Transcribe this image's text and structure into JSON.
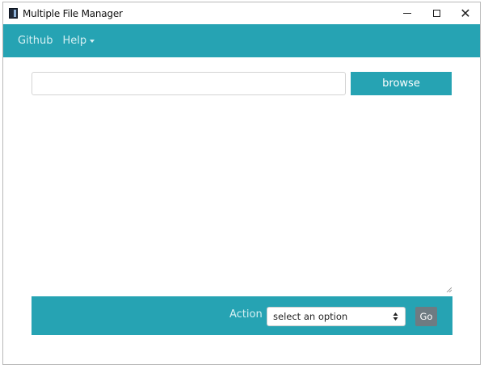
{
  "window": {
    "title": "Multiple File Manager",
    "controls": {
      "minimize": "minimize",
      "maximize": "maximize",
      "close": "✕"
    }
  },
  "navbar": {
    "items": [
      {
        "label": "Github"
      },
      {
        "label": "Help",
        "has_dropdown": true
      }
    ]
  },
  "path_input": {
    "value": "",
    "placeholder": ""
  },
  "browse_button": {
    "label": "browse"
  },
  "action_bar": {
    "label": "Action :",
    "select": {
      "selected": "select an option"
    },
    "go_label": "Go"
  },
  "colors": {
    "accent": "#26a3b3",
    "nav_text": "#d6f0f3",
    "go_button": "#6e7b82"
  },
  "icons": {
    "app": "app-icon",
    "dropdown": "caret-down-icon",
    "select_arrows": "updown-arrows-icon",
    "resize": "resize-grip-icon"
  }
}
